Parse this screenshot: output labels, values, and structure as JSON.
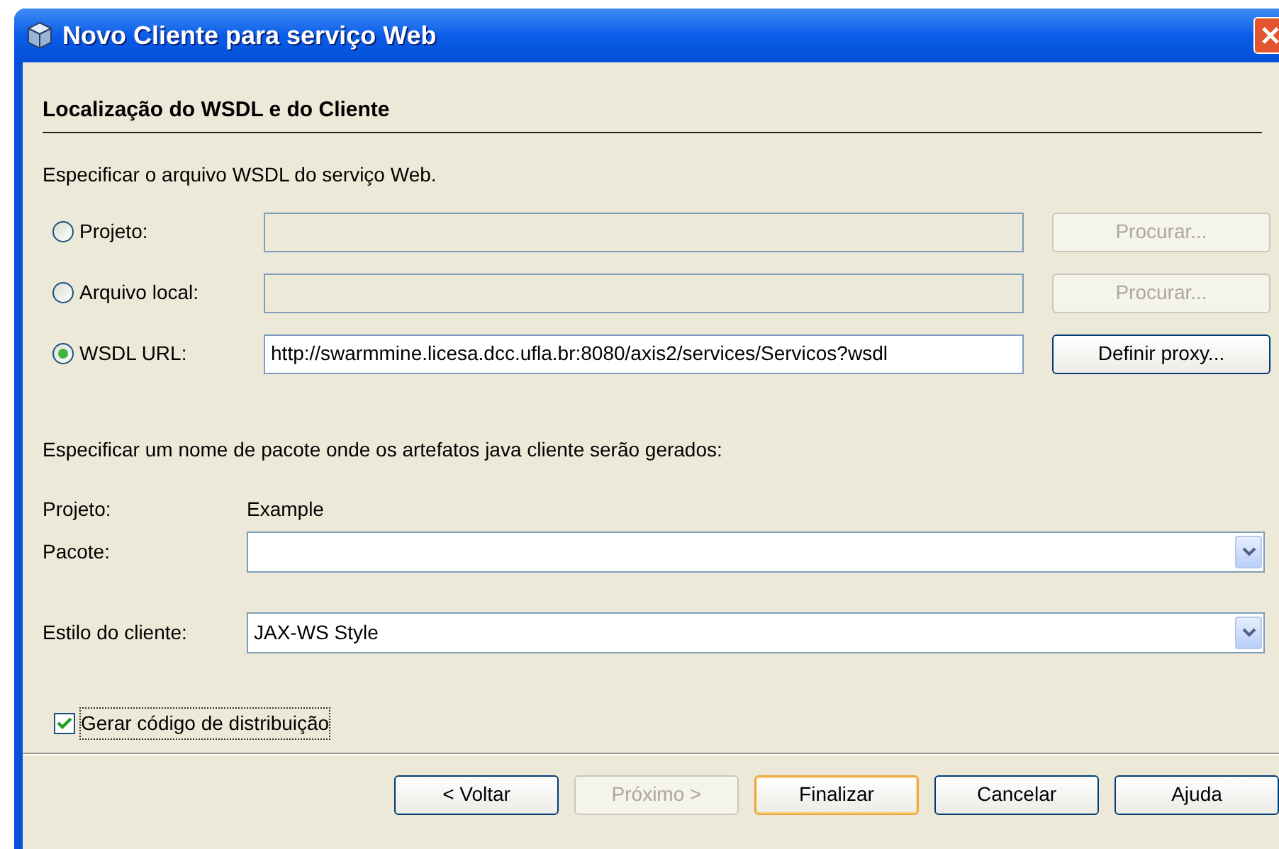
{
  "window": {
    "title": "Novo Cliente para serviço Web"
  },
  "section_title": "Localização do WSDL e do Cliente",
  "intro": "Especificar o arquivo WSDL do serviço Web.",
  "sources": [
    {
      "label": "Projeto:",
      "selected": false,
      "disabled": true,
      "button": {
        "label": "Procurar...",
        "disabled": true
      }
    },
    {
      "label": "Arquivo local:",
      "selected": false,
      "disabled": true,
      "button": {
        "label": "Procurar...",
        "disabled": true
      }
    },
    {
      "label": "WSDL URL:",
      "selected": true,
      "disabled": false,
      "value": "http://swarmmine.licesa.dcc.ufla.br:8080/axis2/services/Servicos?wsdl",
      "button": {
        "label": "Definir proxy...",
        "disabled": false
      }
    }
  ],
  "package_intro": "Especificar um nome de pacote onde os artefatos java cliente serão gerados:",
  "project": {
    "label": "Projeto:",
    "value": "Example"
  },
  "package": {
    "label": "Pacote:"
  },
  "client_style": {
    "label": "Estilo do cliente:",
    "value": "JAX-WS Style"
  },
  "distribution": {
    "label": "Gerar código de distribuição",
    "checked": true
  },
  "buttons": [
    {
      "label": "< Voltar",
      "disabled": false,
      "default": false
    },
    {
      "label": "Próximo >",
      "disabled": true,
      "default": false
    },
    {
      "label": "Finalizar",
      "disabled": false,
      "default": true
    },
    {
      "label": "Cancelar",
      "disabled": false,
      "default": false
    },
    {
      "label": "Ajuda",
      "disabled": false,
      "default": false
    }
  ]
}
